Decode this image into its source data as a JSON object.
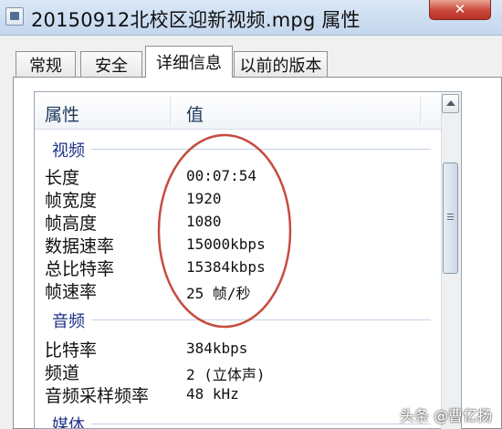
{
  "window": {
    "title": "20150912北校区迎新视频.mpg 属性",
    "close_label": "✕"
  },
  "tabs": [
    {
      "label": "常规"
    },
    {
      "label": "安全"
    },
    {
      "label": "详细信息",
      "active": true
    },
    {
      "label": "以前的版本"
    }
  ],
  "columns": {
    "property": "属性",
    "value": "值"
  },
  "groups": {
    "video": {
      "title": "视频",
      "rows": [
        {
          "name": "长度",
          "value": "00:07:54"
        },
        {
          "name": "帧宽度",
          "value": "1920"
        },
        {
          "name": "帧高度",
          "value": "1080"
        },
        {
          "name": "数据速率",
          "value": "15000kbps"
        },
        {
          "name": "总比特率",
          "value": "15384kbps"
        },
        {
          "name": "帧速率",
          "value": "25 帧/秒"
        }
      ]
    },
    "audio": {
      "title": "音频",
      "rows": [
        {
          "name": "比特率",
          "value": "384kbps"
        },
        {
          "name": "频道",
          "value": "2 (立体声)"
        },
        {
          "name": "音频采样频率",
          "value": "48 kHz"
        }
      ]
    },
    "media": {
      "title": "媒体"
    }
  },
  "watermark": "头条 @曹亿扬",
  "colors": {
    "annotation": "#c0392b",
    "group_title": "#1e3287",
    "header_text": "#1e395b"
  }
}
